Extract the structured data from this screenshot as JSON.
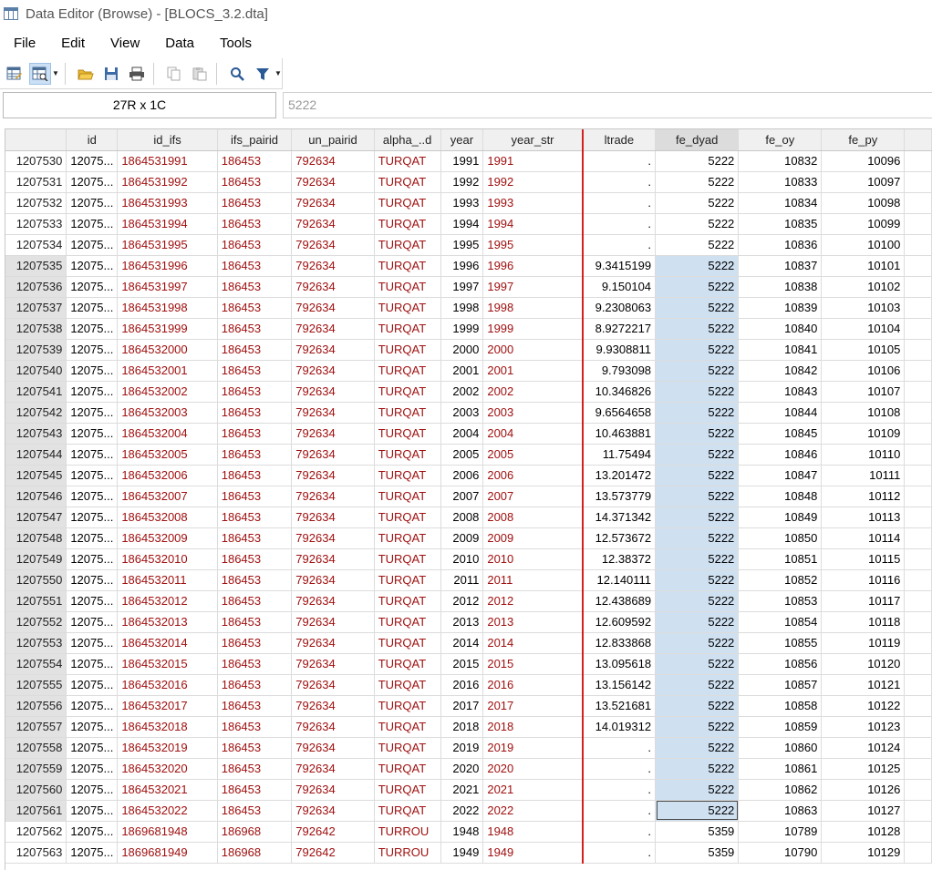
{
  "window": {
    "title": "Data Editor (Browse) - [BLOCS_3.2.dta]"
  },
  "menu": [
    "File",
    "Edit",
    "View",
    "Data",
    "Tools"
  ],
  "toolbar": {
    "icons": [
      "edit-mode-icon",
      "browse-mode-icon",
      "open-folder-icon",
      "save-icon",
      "print-icon",
      "copy-icon",
      "paste-icon",
      "search-icon",
      "filter-icon"
    ]
  },
  "cellbar": {
    "ref": "27R x 1C",
    "value": "5222"
  },
  "grid": {
    "columns": [
      "",
      "id",
      "id_ifs",
      "ifs_pairid",
      "un_pairid",
      "alpha_..d",
      "year",
      "year_str",
      "ltrade",
      "fe_dyad",
      "fe_oy",
      "fe_py"
    ],
    "rows": [
      [
        "1207530",
        "12075...",
        "1864531991",
        "186453",
        "792634",
        "TURQAT",
        "1991",
        "1991",
        ".",
        "5222",
        "10832",
        "10096"
      ],
      [
        "1207531",
        "12075...",
        "1864531992",
        "186453",
        "792634",
        "TURQAT",
        "1992",
        "1992",
        ".",
        "5222",
        "10833",
        "10097"
      ],
      [
        "1207532",
        "12075...",
        "1864531993",
        "186453",
        "792634",
        "TURQAT",
        "1993",
        "1993",
        ".",
        "5222",
        "10834",
        "10098"
      ],
      [
        "1207533",
        "12075...",
        "1864531994",
        "186453",
        "792634",
        "TURQAT",
        "1994",
        "1994",
        ".",
        "5222",
        "10835",
        "10099"
      ],
      [
        "1207534",
        "12075...",
        "1864531995",
        "186453",
        "792634",
        "TURQAT",
        "1995",
        "1995",
        ".",
        "5222",
        "10836",
        "10100"
      ],
      [
        "1207535",
        "12075...",
        "1864531996",
        "186453",
        "792634",
        "TURQAT",
        "1996",
        "1996",
        "9.3415199",
        "5222",
        "10837",
        "10101"
      ],
      [
        "1207536",
        "12075...",
        "1864531997",
        "186453",
        "792634",
        "TURQAT",
        "1997",
        "1997",
        "9.150104",
        "5222",
        "10838",
        "10102"
      ],
      [
        "1207537",
        "12075...",
        "1864531998",
        "186453",
        "792634",
        "TURQAT",
        "1998",
        "1998",
        "9.2308063",
        "5222",
        "10839",
        "10103"
      ],
      [
        "1207538",
        "12075...",
        "1864531999",
        "186453",
        "792634",
        "TURQAT",
        "1999",
        "1999",
        "8.9272217",
        "5222",
        "10840",
        "10104"
      ],
      [
        "1207539",
        "12075...",
        "1864532000",
        "186453",
        "792634",
        "TURQAT",
        "2000",
        "2000",
        "9.9308811",
        "5222",
        "10841",
        "10105"
      ],
      [
        "1207540",
        "12075...",
        "1864532001",
        "186453",
        "792634",
        "TURQAT",
        "2001",
        "2001",
        "9.793098",
        "5222",
        "10842",
        "10106"
      ],
      [
        "1207541",
        "12075...",
        "1864532002",
        "186453",
        "792634",
        "TURQAT",
        "2002",
        "2002",
        "10.346826",
        "5222",
        "10843",
        "10107"
      ],
      [
        "1207542",
        "12075...",
        "1864532003",
        "186453",
        "792634",
        "TURQAT",
        "2003",
        "2003",
        "9.6564658",
        "5222",
        "10844",
        "10108"
      ],
      [
        "1207543",
        "12075...",
        "1864532004",
        "186453",
        "792634",
        "TURQAT",
        "2004",
        "2004",
        "10.463881",
        "5222",
        "10845",
        "10109"
      ],
      [
        "1207544",
        "12075...",
        "1864532005",
        "186453",
        "792634",
        "TURQAT",
        "2005",
        "2005",
        "11.75494",
        "5222",
        "10846",
        "10110"
      ],
      [
        "1207545",
        "12075...",
        "1864532006",
        "186453",
        "792634",
        "TURQAT",
        "2006",
        "2006",
        "13.201472",
        "5222",
        "10847",
        "10111"
      ],
      [
        "1207546",
        "12075...",
        "1864532007",
        "186453",
        "792634",
        "TURQAT",
        "2007",
        "2007",
        "13.573779",
        "5222",
        "10848",
        "10112"
      ],
      [
        "1207547",
        "12075...",
        "1864532008",
        "186453",
        "792634",
        "TURQAT",
        "2008",
        "2008",
        "14.371342",
        "5222",
        "10849",
        "10113"
      ],
      [
        "1207548",
        "12075...",
        "1864532009",
        "186453",
        "792634",
        "TURQAT",
        "2009",
        "2009",
        "12.573672",
        "5222",
        "10850",
        "10114"
      ],
      [
        "1207549",
        "12075...",
        "1864532010",
        "186453",
        "792634",
        "TURQAT",
        "2010",
        "2010",
        "12.38372",
        "5222",
        "10851",
        "10115"
      ],
      [
        "1207550",
        "12075...",
        "1864532011",
        "186453",
        "792634",
        "TURQAT",
        "2011",
        "2011",
        "12.140111",
        "5222",
        "10852",
        "10116"
      ],
      [
        "1207551",
        "12075...",
        "1864532012",
        "186453",
        "792634",
        "TURQAT",
        "2012",
        "2012",
        "12.438689",
        "5222",
        "10853",
        "10117"
      ],
      [
        "1207552",
        "12075...",
        "1864532013",
        "186453",
        "792634",
        "TURQAT",
        "2013",
        "2013",
        "12.609592",
        "5222",
        "10854",
        "10118"
      ],
      [
        "1207553",
        "12075...",
        "1864532014",
        "186453",
        "792634",
        "TURQAT",
        "2014",
        "2014",
        "12.833868",
        "5222",
        "10855",
        "10119"
      ],
      [
        "1207554",
        "12075...",
        "1864532015",
        "186453",
        "792634",
        "TURQAT",
        "2015",
        "2015",
        "13.095618",
        "5222",
        "10856",
        "10120"
      ],
      [
        "1207555",
        "12075...",
        "1864532016",
        "186453",
        "792634",
        "TURQAT",
        "2016",
        "2016",
        "13.156142",
        "5222",
        "10857",
        "10121"
      ],
      [
        "1207556",
        "12075...",
        "1864532017",
        "186453",
        "792634",
        "TURQAT",
        "2017",
        "2017",
        "13.521681",
        "5222",
        "10858",
        "10122"
      ],
      [
        "1207557",
        "12075...",
        "1864532018",
        "186453",
        "792634",
        "TURQAT",
        "2018",
        "2018",
        "14.019312",
        "5222",
        "10859",
        "10123"
      ],
      [
        "1207558",
        "12075...",
        "1864532019",
        "186453",
        "792634",
        "TURQAT",
        "2019",
        "2019",
        ".",
        "5222",
        "10860",
        "10124"
      ],
      [
        "1207559",
        "12075...",
        "1864532020",
        "186453",
        "792634",
        "TURQAT",
        "2020",
        "2020",
        ".",
        "5222",
        "10861",
        "10125"
      ],
      [
        "1207560",
        "12075...",
        "1864532021",
        "186453",
        "792634",
        "TURQAT",
        "2021",
        "2021",
        ".",
        "5222",
        "10862",
        "10126"
      ],
      [
        "1207561",
        "12075...",
        "1864532022",
        "186453",
        "792634",
        "TURQAT",
        "2022",
        "2022",
        ".",
        "5222",
        "10863",
        "10127"
      ],
      [
        "1207562",
        "12075...",
        "1869681948",
        "186968",
        "792642",
        "TURROU",
        "1948",
        "1948",
        ".",
        "5359",
        "10789",
        "10128"
      ],
      [
        "1207563",
        "12075...",
        "1869681949",
        "186968",
        "792642",
        "TURROU",
        "1949",
        "1949",
        ".",
        "5359",
        "10790",
        "10129"
      ]
    ],
    "selection": {
      "column": "fe_dyad",
      "first_row": "1207535",
      "last_row": "1207561",
      "current_row": "1207561"
    }
  },
  "colors": {
    "string_text": "#a01010",
    "selection": "#cfe0f1",
    "sort_divider": "#d42020"
  }
}
